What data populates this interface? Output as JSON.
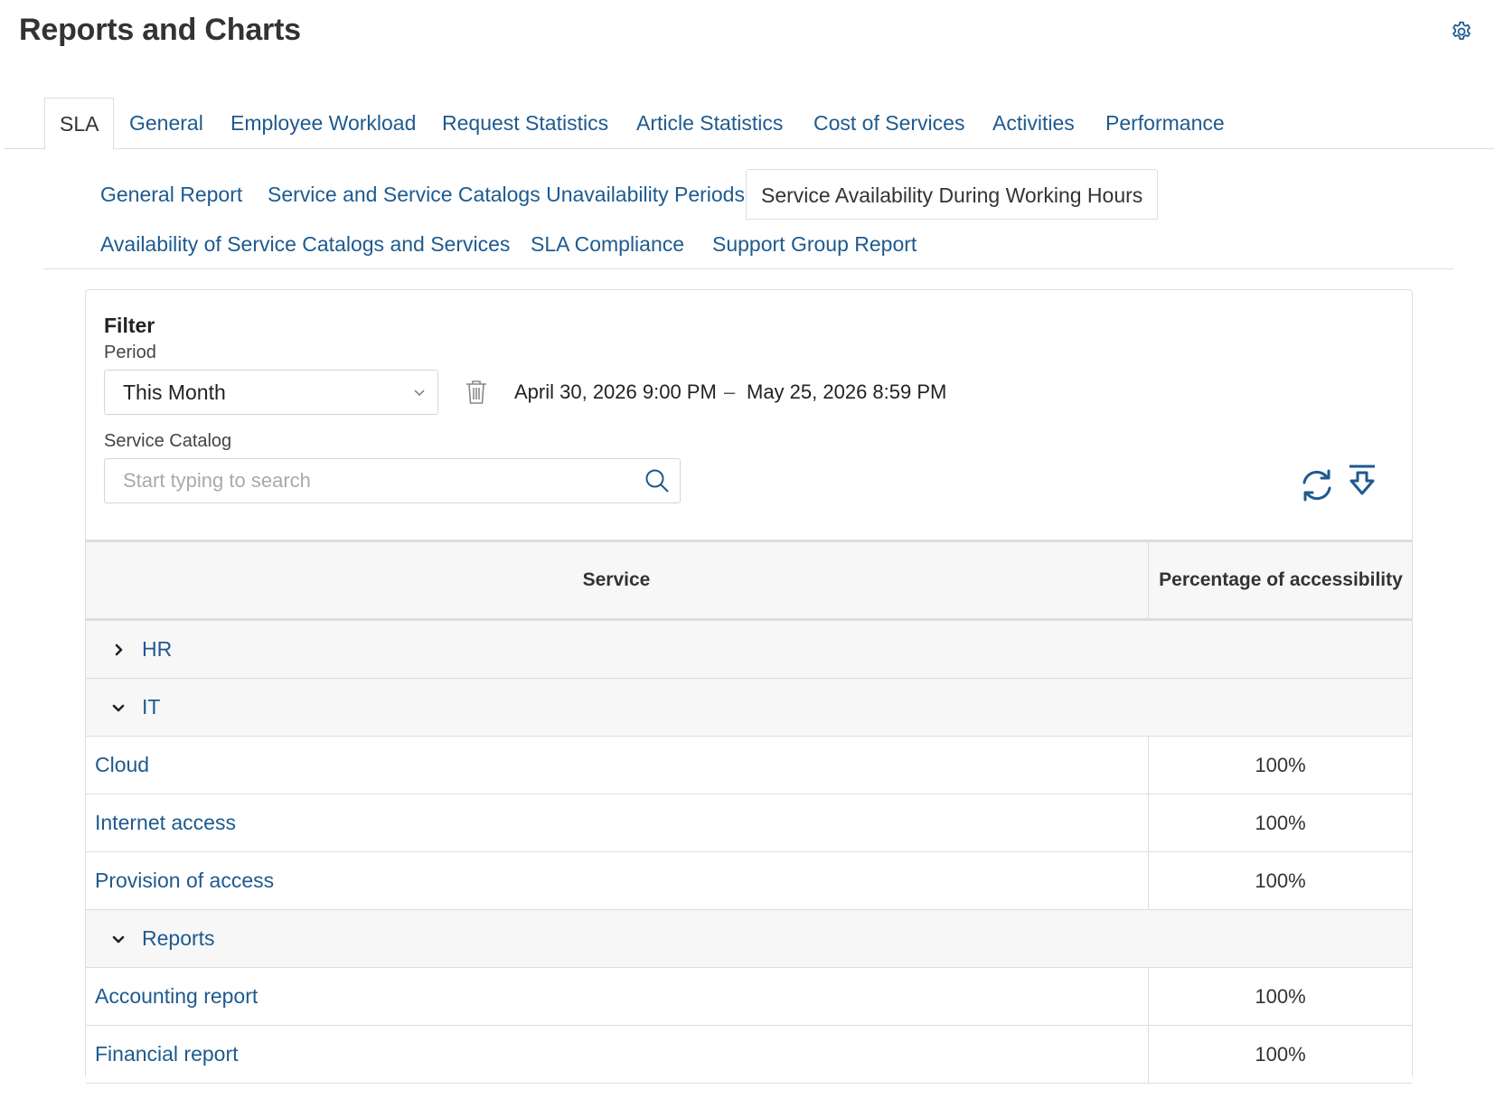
{
  "header": {
    "title": "Reports and Charts",
    "settings_icon": "gear-icon"
  },
  "colors": {
    "link": "#1e5a8f",
    "border": "#dddddd",
    "header_bg": "#f7f7f7"
  },
  "top_tabs": [
    {
      "label": "SLA",
      "active": true
    },
    {
      "label": "General"
    },
    {
      "label": "Employee Workload"
    },
    {
      "label": "Request Statistics"
    },
    {
      "label": "Article Statistics"
    },
    {
      "label": "Cost of Services"
    },
    {
      "label": "Activities"
    },
    {
      "label": "Performance"
    }
  ],
  "sub_tabs": [
    {
      "label": "General Report"
    },
    {
      "label": "Service and Service Catalogs Unavailability Periods"
    },
    {
      "label": "Service Availability During Working Hours",
      "active": true
    },
    {
      "label": "Availability of Service Catalogs and Services"
    },
    {
      "label": "SLA Compliance"
    },
    {
      "label": "Support Group Report"
    }
  ],
  "filter": {
    "title": "Filter",
    "period_label": "Period",
    "period_value": "This Month",
    "date_from": "April 30, 2026 9:00 PM",
    "date_separator": "–",
    "date_to": "May 25, 2026 8:59 PM",
    "catalog_label": "Service Catalog",
    "catalog_placeholder": "Start typing to search",
    "catalog_value": ""
  },
  "table": {
    "columns": [
      "Service",
      "Percentage of accessibility"
    ],
    "groups": [
      {
        "name": "HR",
        "expanded": false,
        "rows": []
      },
      {
        "name": "IT",
        "expanded": true,
        "rows": [
          {
            "service": "Cloud",
            "percentage": "100%"
          },
          {
            "service": "Internet access",
            "percentage": "100%"
          },
          {
            "service": "Provision of access",
            "percentage": "100%"
          }
        ]
      },
      {
        "name": "Reports",
        "expanded": true,
        "rows": [
          {
            "service": "Accounting report",
            "percentage": "100%"
          },
          {
            "service": "Financial report",
            "percentage": "100%"
          }
        ]
      }
    ]
  }
}
